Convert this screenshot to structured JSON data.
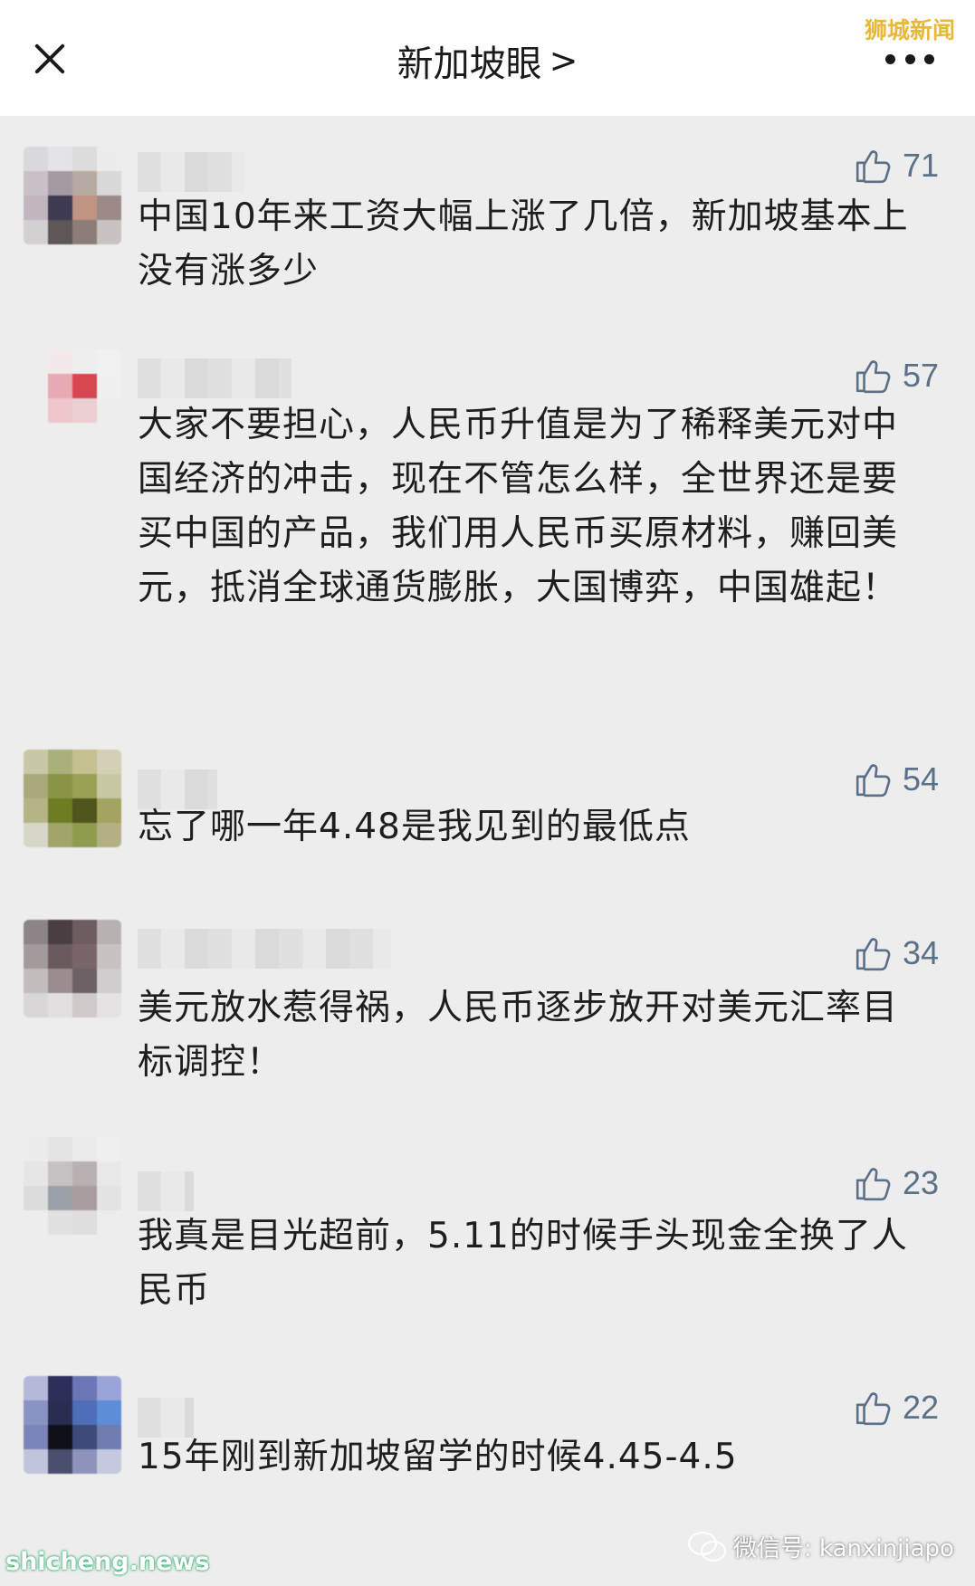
{
  "header": {
    "title": "新加坡眼",
    "chevron": ">",
    "watermark": "狮城新闻"
  },
  "comments": [
    {
      "likes": "71",
      "text": "中国10年来工资大幅上涨了几倍，新加坡基本上没有涨多少"
    },
    {
      "likes": "57",
      "text": "大家不要担心，人民币升值是为了稀释美元对中国经济的冲击，现在不管怎么样，全世界还是要买中国的产品，我们用人民币买原材料，赚回美元，抵消全球通货膨胀，大国博弈，中国雄起！"
    },
    {
      "likes": "54",
      "text": "忘了哪一年4.48是我见到的最低点"
    },
    {
      "likes": "34",
      "text": "美元放水惹得祸，人民币逐步放开对美元汇率目标调控！"
    },
    {
      "likes": "23",
      "text": "我真是目光超前，5.11的时候手头现金全换了人民币"
    },
    {
      "likes": "22",
      "text": "15年刚到新加坡留学的时候4.45-4.5"
    }
  ],
  "footer": {
    "site": "shicheng.news",
    "wechat": "微信号: kanxinjiapo"
  },
  "icons": {
    "like": "thumbs-up-icon",
    "close": "close-icon",
    "more": "more-icon"
  },
  "colors": {
    "like_count": "#5c7087",
    "background": "#ededed",
    "watermark": "#e8b83a"
  }
}
